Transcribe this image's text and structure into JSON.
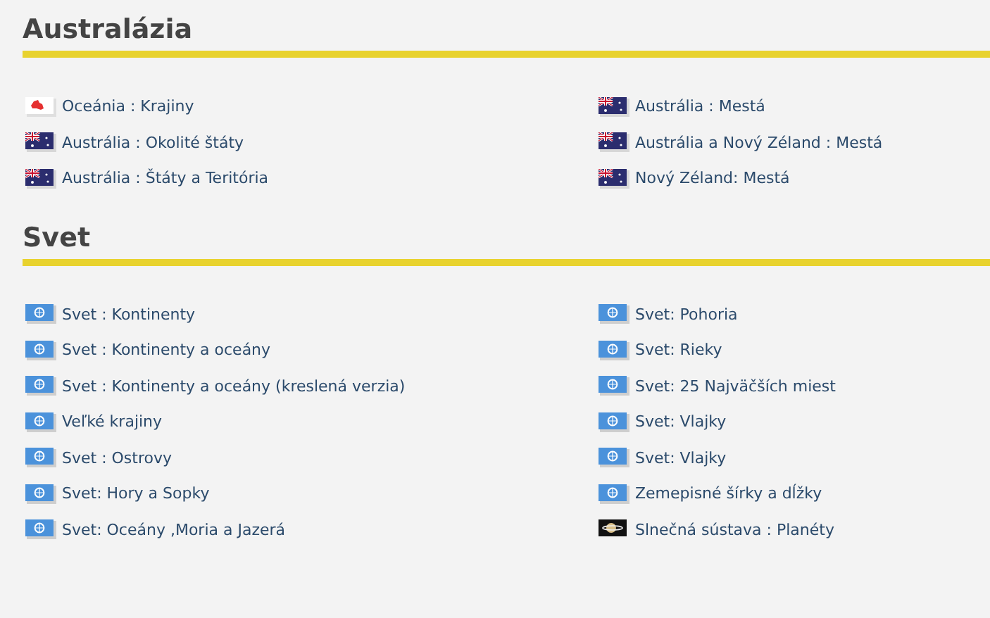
{
  "sections": [
    {
      "title": "Australázia",
      "columns": [
        [
          {
            "label": "Oceánia : Krajiny",
            "kind": "map"
          },
          {
            "label": "Austrália : Okolité štáty",
            "kind": "flag"
          },
          {
            "label": "Austrália : Štáty a Teritória",
            "kind": "flag"
          }
        ],
        [
          {
            "label": "Austrália : Mestá",
            "kind": "flag"
          },
          {
            "label": "Austrália a Nový Zéland : Mestá",
            "kind": "flag"
          },
          {
            "label": "Nový Zéland: Mestá",
            "kind": "flag"
          }
        ]
      ]
    },
    {
      "title": "Svet",
      "columns": [
        [
          {
            "label": "Svet : Kontinenty",
            "kind": "world"
          },
          {
            "label": "Svet : Kontinenty a oceány",
            "kind": "world"
          },
          {
            "label": "Svet : Kontinenty a oceány (kreslená verzia)",
            "kind": "world"
          },
          {
            "label": "Veľké krajiny",
            "kind": "world"
          },
          {
            "label": "Svet : Ostrovy",
            "kind": "world"
          },
          {
            "label": "Svet: Hory a Sopky",
            "kind": "world"
          },
          {
            "label": "Svet: Oceány ,Moria a Jazerá",
            "kind": "world"
          }
        ],
        [
          {
            "label": "Svet: Pohoria",
            "kind": "world"
          },
          {
            "label": "Svet: Rieky",
            "kind": "world"
          },
          {
            "label": "Svet: 25 Najväčších miest",
            "kind": "world"
          },
          {
            "label": "Svet: Vlajky",
            "kind": "world"
          },
          {
            "label": "Svet: Vlajky",
            "kind": "world"
          },
          {
            "label": "Zemepisné šírky a dĺžky",
            "kind": "world"
          },
          {
            "label": "Slnečná sústava : Planéty",
            "kind": "planet"
          }
        ]
      ]
    }
  ]
}
